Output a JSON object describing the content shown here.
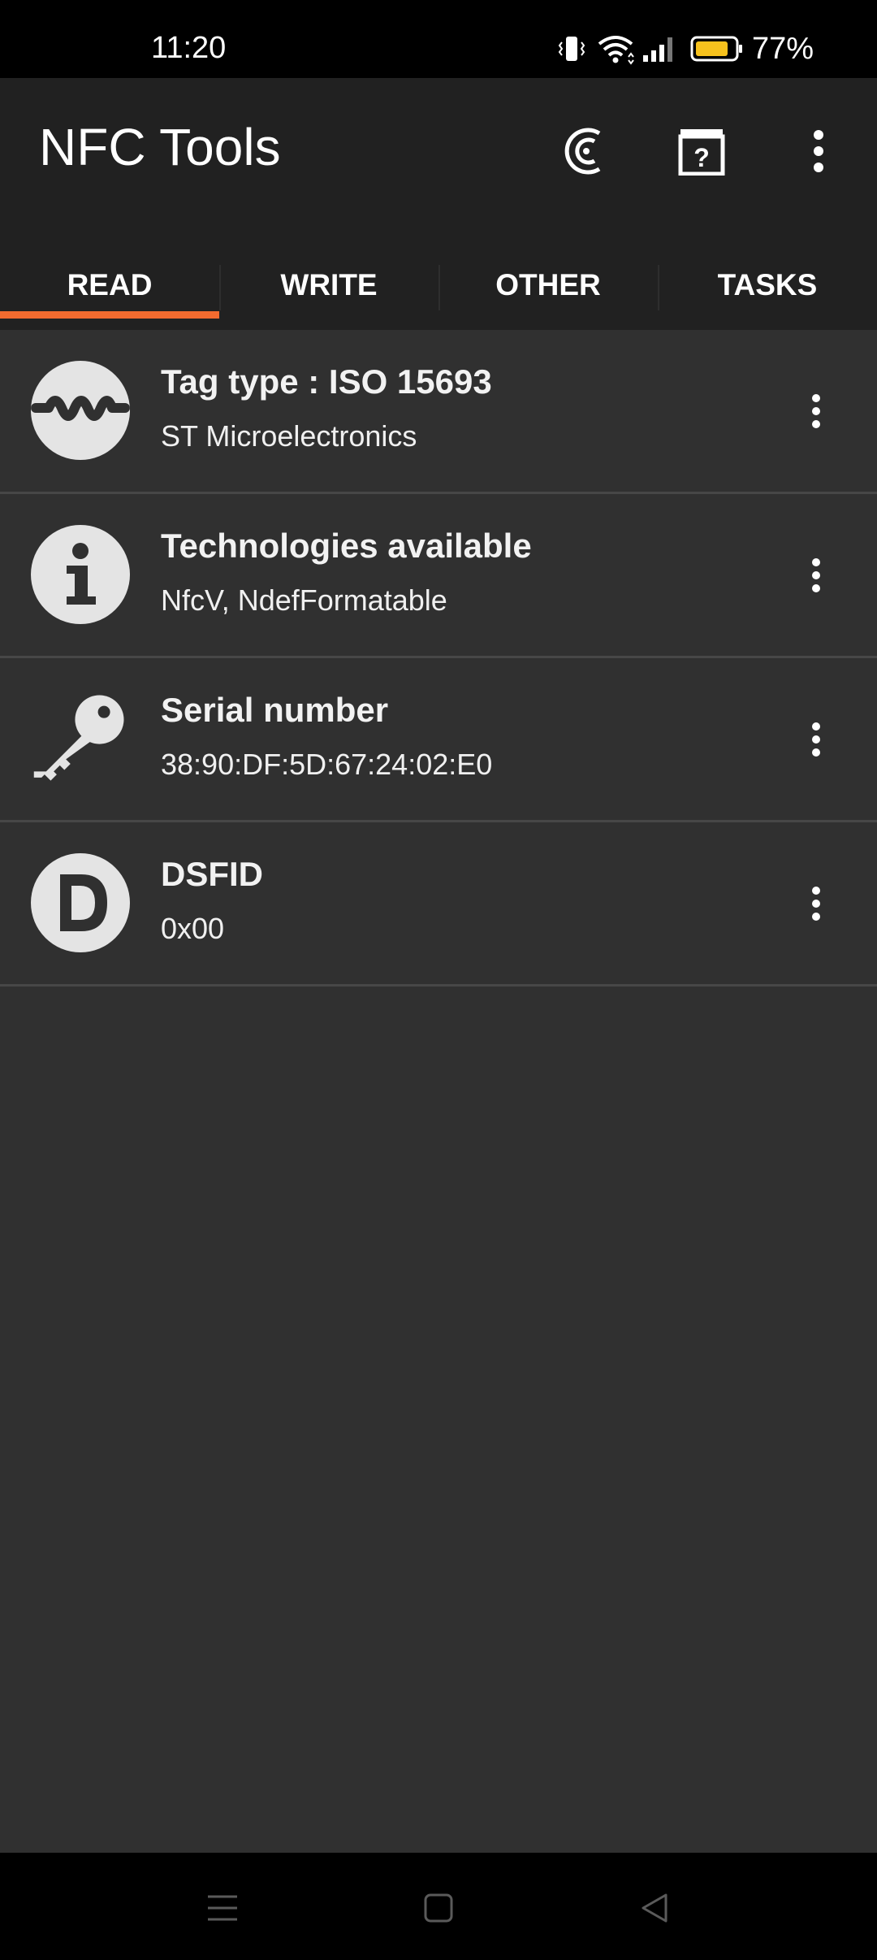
{
  "status_bar": {
    "time": "11:20",
    "battery_percent": "77%",
    "icons": [
      "vibrate-icon",
      "wifi-icon",
      "signal-icon",
      "battery-icon"
    ],
    "battery_color": "#f7c21d"
  },
  "app_bar": {
    "title": "NFC Tools",
    "actions": [
      "nfc-icon",
      "help-icon",
      "more-vert-icon"
    ]
  },
  "tabs": [
    {
      "label": "READ",
      "active": true
    },
    {
      "label": "WRITE",
      "active": false
    },
    {
      "label": "OTHER",
      "active": false
    },
    {
      "label": "TASKS",
      "active": false
    }
  ],
  "accent_color": "#f26b2f",
  "items": [
    {
      "icon": "wave-icon",
      "title": "Tag type : ISO 15693",
      "subtitle": "ST Microelectronics"
    },
    {
      "icon": "info-icon",
      "title": "Technologies available",
      "subtitle": "NfcV, NdefFormatable"
    },
    {
      "icon": "key-icon",
      "title": "Serial number",
      "subtitle": "38:90:DF:5D:67:24:02:E0"
    },
    {
      "icon": "letter-d-icon",
      "title": "DSFID",
      "subtitle": "0x00"
    }
  ],
  "nav_bar": {
    "buttons": [
      "menu-icon",
      "home-icon",
      "back-icon"
    ]
  }
}
